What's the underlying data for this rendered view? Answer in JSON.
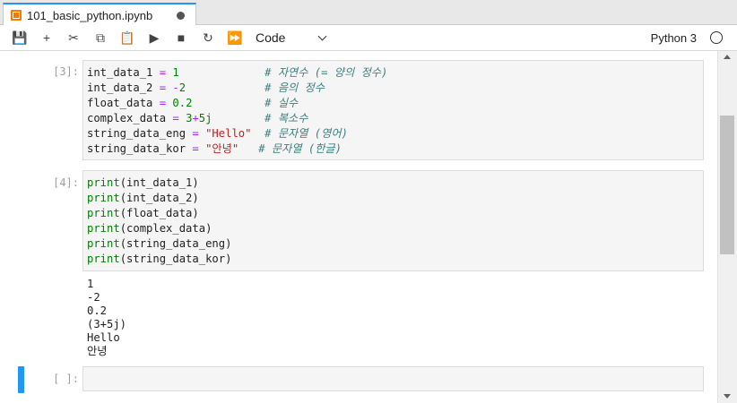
{
  "tab": {
    "title": "101_basic_python.ipynb",
    "icon": "notebook-icon",
    "close_icon": "unsaved-dot-icon"
  },
  "toolbar": {
    "buttons": [
      {
        "name": "save",
        "icon": "save-icon",
        "glyph": "💾"
      },
      {
        "name": "insert-cell",
        "icon": "plus-icon",
        "glyph": "+"
      },
      {
        "name": "cut",
        "icon": "scissors-icon",
        "glyph": "✂"
      },
      {
        "name": "copy",
        "icon": "copy-icon",
        "glyph": "⧉"
      },
      {
        "name": "paste",
        "icon": "clipboard-icon",
        "glyph": "📋"
      },
      {
        "name": "run",
        "icon": "play-icon",
        "glyph": "▶"
      },
      {
        "name": "interrupt",
        "icon": "stop-icon",
        "glyph": "■"
      },
      {
        "name": "restart",
        "icon": "restart-icon",
        "glyph": "↻"
      },
      {
        "name": "run-all",
        "icon": "fast-forward-icon",
        "glyph": "⏩"
      }
    ],
    "cell_type": "Code",
    "kernel": "Python 3"
  },
  "cells": [
    {
      "prompt": "[3]:",
      "lines": [
        [
          [
            "",
            "int_data_1 "
          ],
          [
            "op",
            "="
          ],
          [
            "",
            " "
          ],
          [
            "num",
            "1"
          ],
          [
            "",
            "             "
          ],
          [
            "cm",
            "# 자연수 (= 양의 정수)"
          ]
        ],
        [
          [
            "",
            "int_data_2 "
          ],
          [
            "op",
            "="
          ],
          [
            "",
            " "
          ],
          [
            "op",
            "-"
          ],
          [
            "num",
            "2"
          ],
          [
            "",
            "            "
          ],
          [
            "cm",
            "# 음의 정수"
          ]
        ],
        [
          [
            "",
            "float_data "
          ],
          [
            "op",
            "="
          ],
          [
            "",
            " "
          ],
          [
            "num",
            "0.2"
          ],
          [
            "",
            "           "
          ],
          [
            "cm",
            "# 실수"
          ]
        ],
        [
          [
            "",
            "complex_data "
          ],
          [
            "op",
            "="
          ],
          [
            "",
            " "
          ],
          [
            "num",
            "3"
          ],
          [
            "op",
            "+"
          ],
          [
            "num",
            "5j"
          ],
          [
            "",
            "        "
          ],
          [
            "cm",
            "# 복소수"
          ]
        ],
        [
          [
            "",
            "string_data_eng "
          ],
          [
            "op",
            "="
          ],
          [
            "",
            " "
          ],
          [
            "str",
            "\"Hello\""
          ],
          [
            "",
            "  "
          ],
          [
            "cm",
            "# 문자열 (영어)"
          ]
        ],
        [
          [
            "",
            "string_data_kor "
          ],
          [
            "op",
            "="
          ],
          [
            "",
            " "
          ],
          [
            "str",
            "\"안녕\""
          ],
          [
            "",
            "   "
          ],
          [
            "cm",
            "# 문자열 (한글)"
          ]
        ]
      ]
    },
    {
      "prompt": "[4]:",
      "lines": [
        [
          [
            "kw",
            "print"
          ],
          [
            "",
            "(int_data_1)"
          ]
        ],
        [
          [
            "kw",
            "print"
          ],
          [
            "",
            "(int_data_2)"
          ]
        ],
        [
          [
            "kw",
            "print"
          ],
          [
            "",
            "(float_data)"
          ]
        ],
        [
          [
            "kw",
            "print"
          ],
          [
            "",
            "(complex_data)"
          ]
        ],
        [
          [
            "kw",
            "print"
          ],
          [
            "",
            "(string_data_eng)"
          ]
        ],
        [
          [
            "kw",
            "print"
          ],
          [
            "",
            "(string_data_kor)"
          ]
        ]
      ],
      "output": [
        "1",
        "-2",
        "0.2",
        "(3+5j)",
        "Hello",
        "안녕"
      ]
    },
    {
      "prompt": "[ ]:",
      "lines": []
    }
  ]
}
